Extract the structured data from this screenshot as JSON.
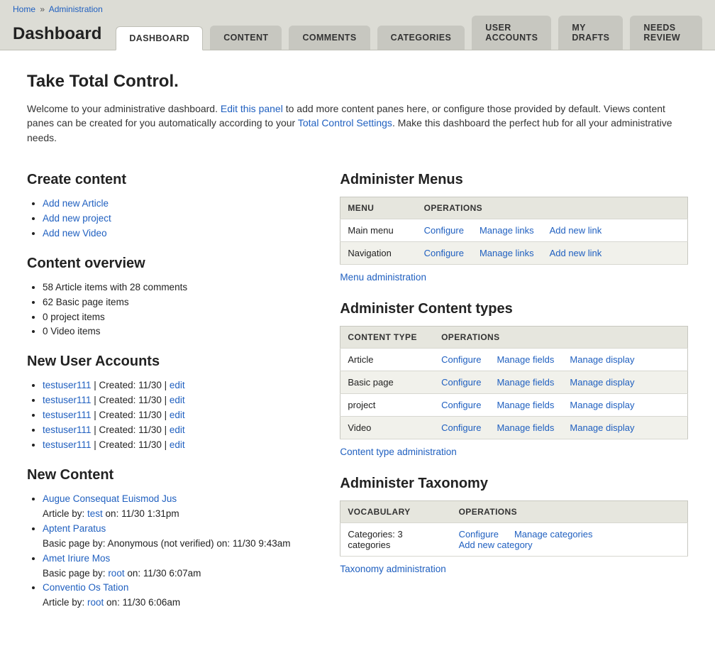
{
  "breadcrumb": {
    "home": "Home",
    "sep": "»",
    "admin": "Administration"
  },
  "page_title": "Dashboard",
  "tabs": [
    {
      "label": "DASHBOARD",
      "active": true
    },
    {
      "label": "CONTENT"
    },
    {
      "label": "COMMENTS"
    },
    {
      "label": "CATEGORIES"
    },
    {
      "label": "USER ACCOUNTS"
    },
    {
      "label": "MY DRAFTS"
    },
    {
      "label": "NEEDS REVIEW"
    }
  ],
  "section_title": "Take Total Control.",
  "intro": {
    "p1": "Welcome to your administrative dashboard. ",
    "link1": "Edit this panel",
    "p2": " to add more content panes here, or configure those provided by default. Views content panes can be created for you automatically according to your ",
    "link2": "Total Control Settings",
    "p3": ". Make this dashboard the perfect hub for all your administrative needs."
  },
  "create_content": {
    "title": "Create content",
    "items": [
      "Add new Article",
      "Add new project",
      "Add new Video"
    ]
  },
  "content_overview": {
    "title": "Content overview",
    "items": [
      "58 Article items with 28 comments",
      "62 Basic page items",
      "0 project items",
      "0 Video items"
    ]
  },
  "new_users": {
    "title": "New User Accounts",
    "rows": [
      {
        "user": "testuser111",
        "sep": " | Created: 11/30 | ",
        "edit": "edit"
      },
      {
        "user": "testuser111",
        "sep": " | Created: 11/30 | ",
        "edit": "edit"
      },
      {
        "user": "testuser111",
        "sep": " | Created: 11/30 | ",
        "edit": "edit"
      },
      {
        "user": "testuser111",
        "sep": " | Created: 11/30 | ",
        "edit": "edit"
      },
      {
        "user": "testuser111",
        "sep": " | Created: 11/30 | ",
        "edit": "edit"
      }
    ]
  },
  "new_content": {
    "title": "New Content",
    "rows": [
      {
        "title": "Augue Consequat Euismod Jus",
        "meta_pre": "Article by: ",
        "author": "test",
        "meta_post": " on: 11/30 1:31pm"
      },
      {
        "title": "Aptent Paratus",
        "meta_pre": "Basic page by: Anonymous (not verified) on: 11/30 9:43am",
        "author": "",
        "meta_post": ""
      },
      {
        "title": "Amet Iriure Mos",
        "meta_pre": "Basic page by: ",
        "author": "root",
        "meta_post": " on: 11/30 6:07am"
      },
      {
        "title": "Conventio Os Tation",
        "meta_pre": "Article by: ",
        "author": "root",
        "meta_post": " on: 11/30 6:06am"
      }
    ]
  },
  "menus": {
    "title": "Administer Menus",
    "th_menu": "MENU",
    "th_ops": "OPERATIONS",
    "rows": [
      {
        "name": "Main menu",
        "ops": [
          "Configure",
          "Manage links",
          "Add new link"
        ]
      },
      {
        "name": "Navigation",
        "ops": [
          "Configure",
          "Manage links",
          "Add new link"
        ]
      }
    ],
    "footer": "Menu administration"
  },
  "content_types": {
    "title": "Administer Content types",
    "th_type": "CONTENT TYPE",
    "th_ops": "OPERATIONS",
    "rows": [
      {
        "name": "Article",
        "ops": [
          "Configure",
          "Manage fields",
          "Manage display"
        ]
      },
      {
        "name": "Basic page",
        "ops": [
          "Configure",
          "Manage fields",
          "Manage display"
        ]
      },
      {
        "name": "project",
        "ops": [
          "Configure",
          "Manage fields",
          "Manage display"
        ]
      },
      {
        "name": "Video",
        "ops": [
          "Configure",
          "Manage fields",
          "Manage display"
        ]
      }
    ],
    "footer": "Content type administration"
  },
  "taxonomy": {
    "title": "Administer Taxonomy",
    "th_vocab": "VOCABULARY",
    "th_ops": "OPERATIONS",
    "rows": [
      {
        "name": "Categories: 3 categories",
        "ops": [
          "Configure",
          "Manage categories",
          "Add new category"
        ]
      }
    ],
    "footer": "Taxonomy administration"
  }
}
